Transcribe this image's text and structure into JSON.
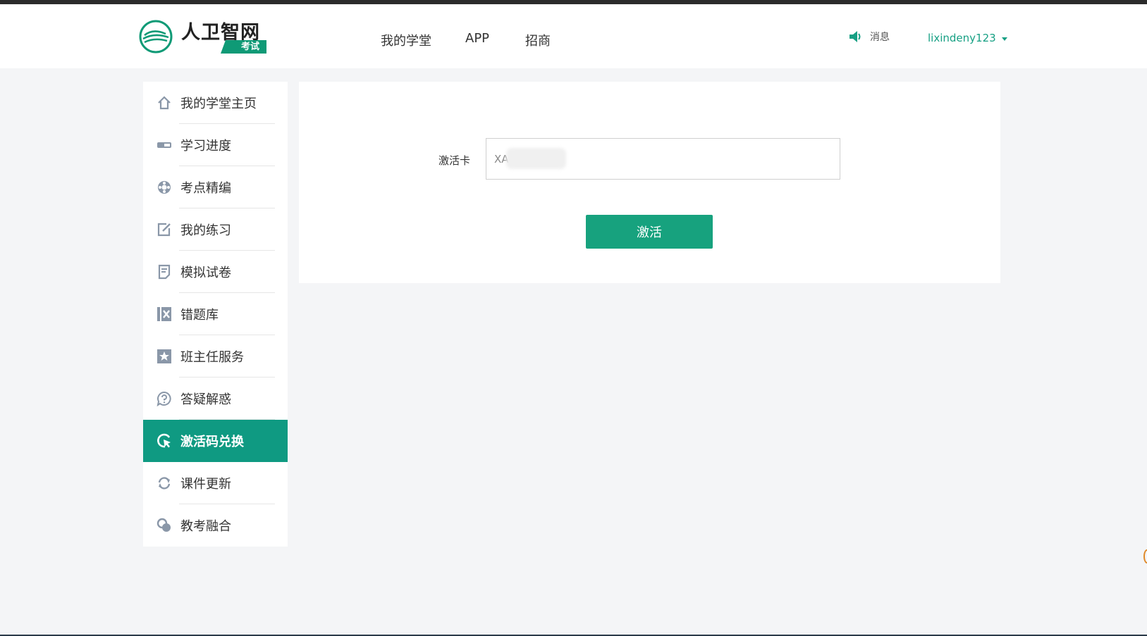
{
  "header": {
    "logo_title": "人卫智网",
    "logo_badge": "考试",
    "nav": [
      "我的学堂",
      "APP",
      "招商"
    ],
    "message_label": "消息",
    "username": "lixindeny123"
  },
  "sidebar": {
    "items": [
      {
        "label": "我的学堂主页",
        "icon": "home-icon"
      },
      {
        "label": "学习进度",
        "icon": "progress-icon"
      },
      {
        "label": "考点精编",
        "icon": "lifebuoy-icon"
      },
      {
        "label": "我的练习",
        "icon": "edit-icon"
      },
      {
        "label": "模拟试卷",
        "icon": "document-icon"
      },
      {
        "label": "错题库",
        "icon": "wrong-book-icon"
      },
      {
        "label": "班主任服务",
        "icon": "star-icon"
      },
      {
        "label": "答疑解惑",
        "icon": "question-icon"
      },
      {
        "label": "激活码兑换",
        "icon": "cursor-click-icon",
        "active": true
      },
      {
        "label": "课件更新",
        "icon": "refresh-icon"
      },
      {
        "label": "教考融合",
        "icon": "link-circles-icon"
      }
    ]
  },
  "form": {
    "field_label": "激活卡",
    "input_value": "XA",
    "button_label": "激活"
  },
  "colors": {
    "accent": "#0f9a82",
    "button": "#17a27e",
    "username": "#17a084"
  }
}
